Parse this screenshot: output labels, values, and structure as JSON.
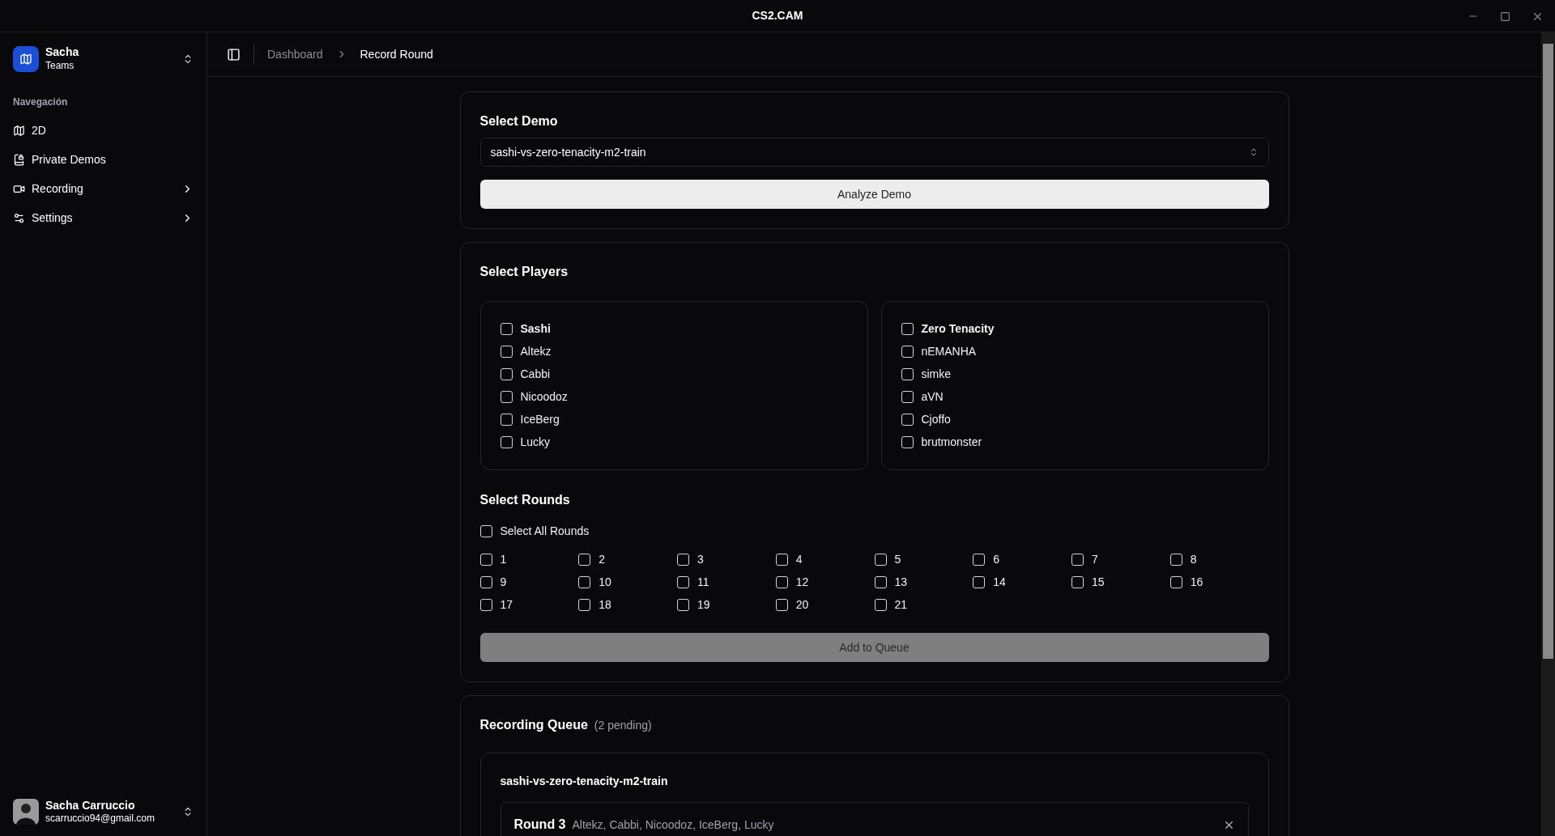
{
  "window": {
    "title": "CS2.CAM"
  },
  "sidebar": {
    "team": {
      "name": "Sacha",
      "plan": "Teams"
    },
    "section_label": "Navegación",
    "items": [
      {
        "label": "2D",
        "kind": "map",
        "has_submenu": false
      },
      {
        "label": "Private Demos",
        "kind": "demos",
        "has_submenu": false
      },
      {
        "label": "Recording",
        "kind": "recording",
        "has_submenu": true
      },
      {
        "label": "Settings",
        "kind": "settings",
        "has_submenu": true
      }
    ],
    "user": {
      "name": "Sacha Carruccio",
      "email": "scarruccio94@gmail.com"
    }
  },
  "breadcrumb": [
    "Dashboard",
    "Record Round"
  ],
  "select_demo": {
    "title": "Select Demo",
    "value": "sashi-vs-zero-tenacity-m2-train",
    "button": "Analyze Demo"
  },
  "select_players": {
    "title": "Select Players",
    "teams": [
      {
        "name": "Sashi",
        "checked": false,
        "players": [
          {
            "name": "Altekz",
            "checked": false
          },
          {
            "name": "Cabbi",
            "checked": false
          },
          {
            "name": "Nicoodoz",
            "checked": false
          },
          {
            "name": "IceBerg",
            "checked": false
          },
          {
            "name": "Lucky",
            "checked": false
          }
        ]
      },
      {
        "name": "Zero Tenacity",
        "checked": false,
        "players": [
          {
            "name": "nEMANHA",
            "checked": false
          },
          {
            "name": "simke",
            "checked": false
          },
          {
            "name": "aVN",
            "checked": false
          },
          {
            "name": "Cjoffo",
            "checked": false
          },
          {
            "name": "brutmonster",
            "checked": false
          }
        ]
      }
    ]
  },
  "select_rounds": {
    "title": "Select Rounds",
    "select_all": {
      "label": "Select All Rounds",
      "checked": false
    },
    "rounds": [
      {
        "label": "1",
        "checked": false
      },
      {
        "label": "2",
        "checked": false
      },
      {
        "label": "3",
        "checked": false
      },
      {
        "label": "4",
        "checked": false
      },
      {
        "label": "5",
        "checked": false
      },
      {
        "label": "6",
        "checked": false
      },
      {
        "label": "7",
        "checked": false
      },
      {
        "label": "8",
        "checked": false
      },
      {
        "label": "9",
        "checked": false
      },
      {
        "label": "10",
        "checked": false
      },
      {
        "label": "11",
        "checked": false
      },
      {
        "label": "12",
        "checked": false
      },
      {
        "label": "13",
        "checked": false
      },
      {
        "label": "14",
        "checked": false
      },
      {
        "label": "15",
        "checked": false
      },
      {
        "label": "16",
        "checked": false
      },
      {
        "label": "17",
        "checked": false
      },
      {
        "label": "18",
        "checked": false
      },
      {
        "label": "19",
        "checked": false
      },
      {
        "label": "20",
        "checked": false
      },
      {
        "label": "21",
        "checked": false
      }
    ],
    "button": {
      "label": "Add to Queue",
      "disabled": true
    }
  },
  "queue": {
    "title": "Recording Queue",
    "count": "(2 pending)",
    "groups": [
      {
        "demo": "sashi-vs-zero-tenacity-m2-train",
        "items": [
          {
            "round": "Round 3",
            "players": "Altekz, Cabbi, Nicoodoz, IceBerg, Lucky"
          }
        ]
      }
    ]
  }
}
